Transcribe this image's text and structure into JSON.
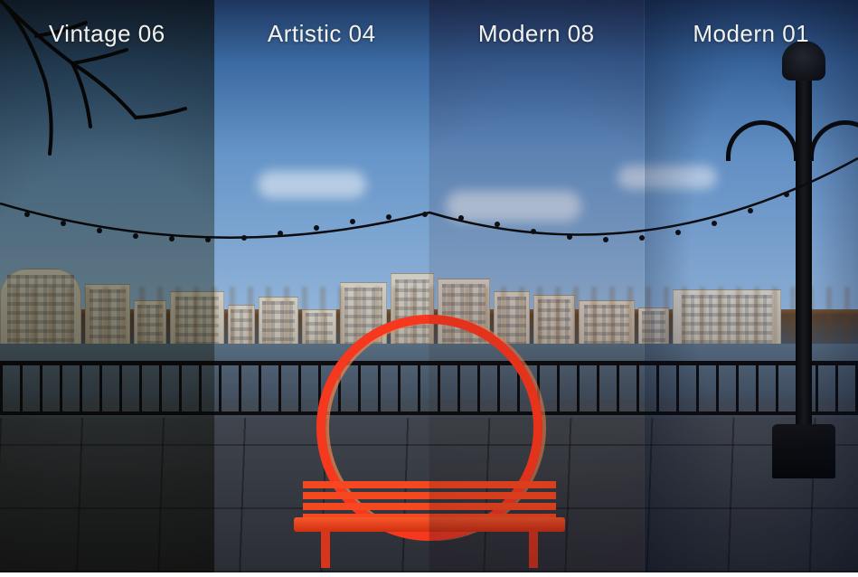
{
  "filters": [
    {
      "id": "vintage-06",
      "label": "Vintage 06",
      "class": "f-vintage"
    },
    {
      "id": "artistic-04",
      "label": "Artistic 04",
      "class": "f-artistic"
    },
    {
      "id": "modern-08",
      "label": "Modern 08",
      "class": "f-modern08"
    },
    {
      "id": "modern-01",
      "label": "Modern 01",
      "class": "f-modern01"
    }
  ]
}
